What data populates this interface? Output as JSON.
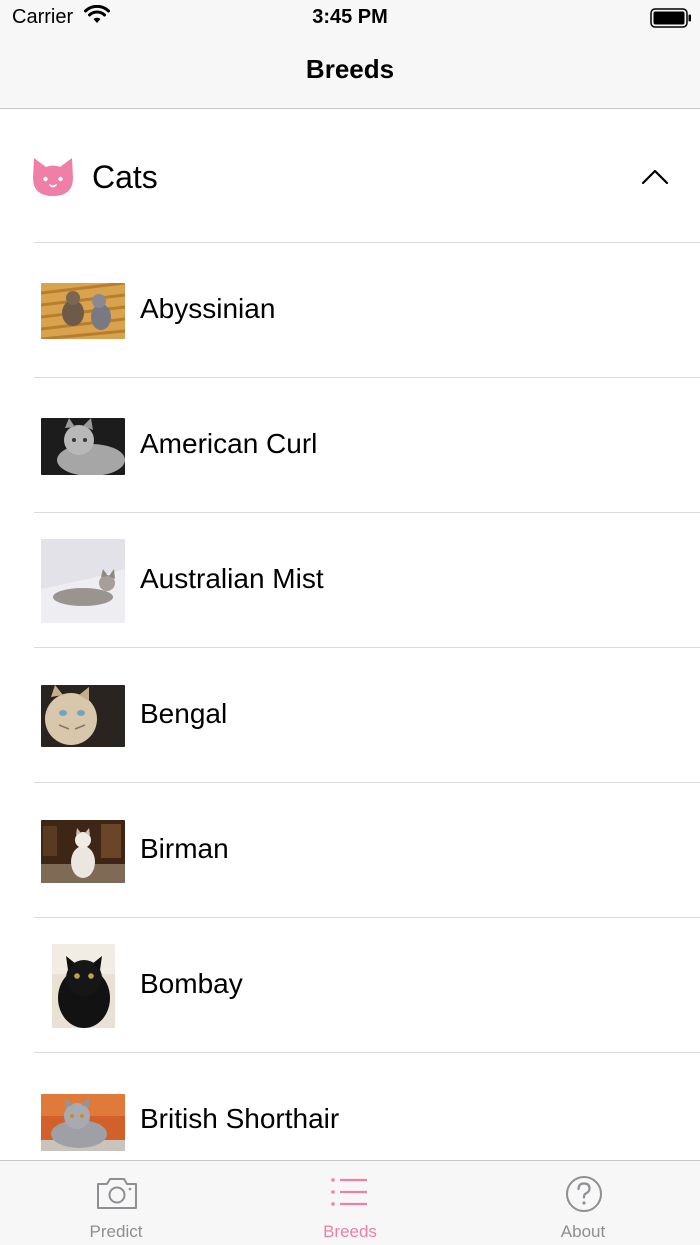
{
  "status_bar": {
    "carrier": "Carrier",
    "time": "3:45 PM"
  },
  "nav": {
    "title": "Breeds"
  },
  "section": {
    "title": "Cats",
    "icon": "cat-face-icon",
    "icon_color": "#ef7fa6",
    "expanded": true
  },
  "breeds": [
    {
      "name": "Abyssinian"
    },
    {
      "name": "American Curl"
    },
    {
      "name": "Australian Mist"
    },
    {
      "name": "Bengal"
    },
    {
      "name": "Birman"
    },
    {
      "name": "Bombay"
    },
    {
      "name": "British Shorthair"
    }
  ],
  "tabs": [
    {
      "label": "Predict",
      "icon": "camera-icon",
      "active": false
    },
    {
      "label": "Breeds",
      "icon": "list-icon",
      "active": true
    },
    {
      "label": "About",
      "icon": "question-circle-icon",
      "active": false
    }
  ],
  "colors": {
    "accent": "#ef7fa6",
    "inactive": "#8e8e93"
  }
}
